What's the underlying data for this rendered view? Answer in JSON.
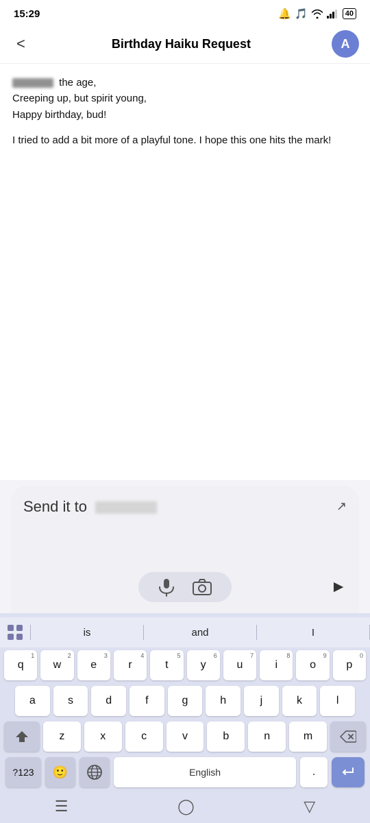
{
  "statusBar": {
    "time": "15:29",
    "battery": "40"
  },
  "header": {
    "title": "Birthday Haiku Request",
    "avatar": "A",
    "backLabel": "<"
  },
  "chat": {
    "haiku": {
      "line1": "the age,",
      "line2": "Creeping up, but spirit young,",
      "line3": "Happy birthday, bud!"
    },
    "note": "I tried to add a bit more of a playful tone. I hope this one hits the mark!"
  },
  "inputArea": {
    "prefixText": "Send it to"
  },
  "keyboard": {
    "suggestions": [
      "is",
      "and",
      "I"
    ],
    "rows": [
      [
        "q",
        "w",
        "e",
        "r",
        "t",
        "y",
        "u",
        "i",
        "o",
        "p"
      ],
      [
        "a",
        "s",
        "d",
        "f",
        "g",
        "h",
        "j",
        "k",
        "l"
      ],
      [
        "z",
        "x",
        "c",
        "v",
        "b",
        "n",
        "m"
      ]
    ],
    "numberKey": "?123",
    "spaceLabel": "English",
    "periodLabel": ".",
    "superscripts": [
      "1",
      "2",
      "3",
      "4",
      "5",
      "6",
      "7",
      "8",
      "9",
      "0"
    ]
  }
}
